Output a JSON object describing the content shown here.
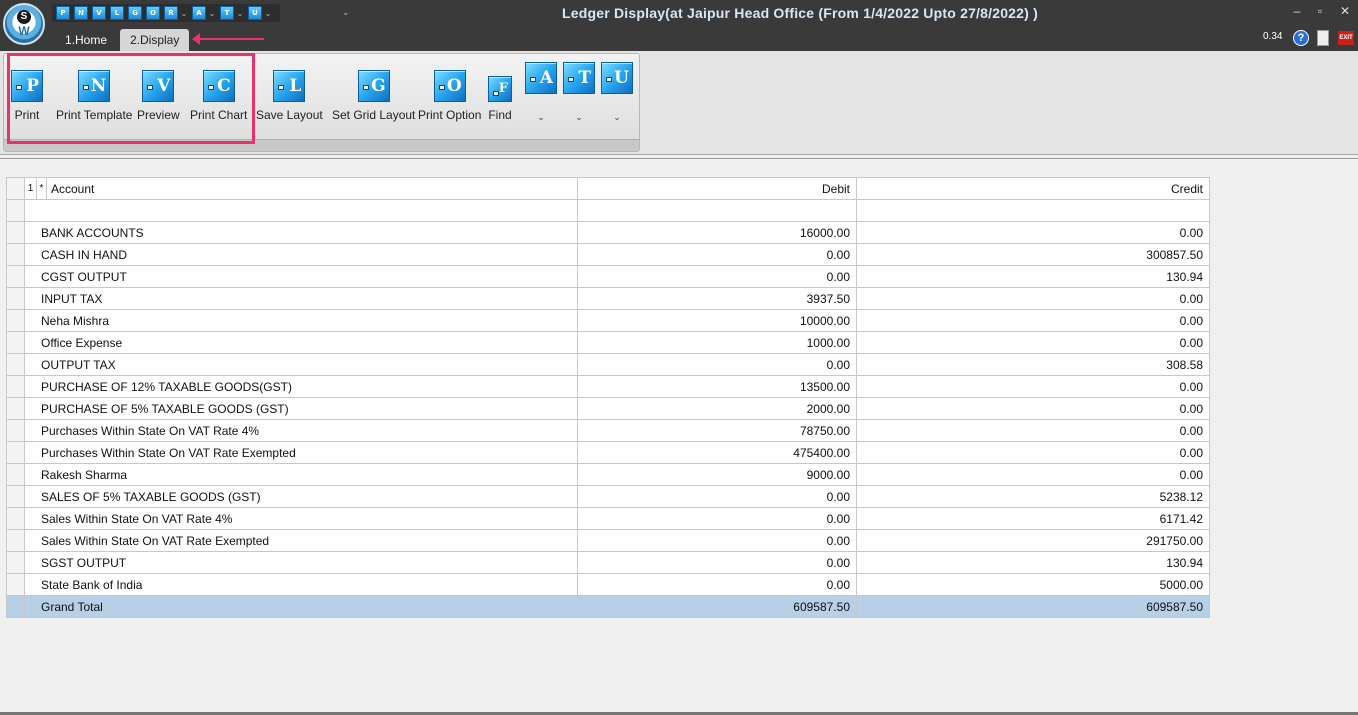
{
  "window": {
    "title": "Ledger Display(at Jaipur Head Office  (From 1/4/2022 Upto 27/8/2022) )",
    "version": "0.34"
  },
  "quick_access": [
    {
      "letter": "P",
      "icon": "print-icon"
    },
    {
      "letter": "N",
      "icon": "print-template-icon"
    },
    {
      "letter": "V",
      "icon": "preview-icon"
    },
    {
      "letter": "L",
      "icon": "save-layout-icon"
    },
    {
      "letter": "G",
      "icon": "grid-layout-icon"
    },
    {
      "letter": "O",
      "icon": "print-option-icon"
    },
    {
      "letter": "R",
      "icon": "r-icon"
    },
    {
      "letter": "A",
      "icon": "a-icon"
    },
    {
      "letter": "T",
      "icon": "t-icon"
    },
    {
      "letter": "U",
      "icon": "u-icon"
    }
  ],
  "tabs": [
    {
      "label": "1.Home"
    },
    {
      "label": "2.Display"
    }
  ],
  "ribbon": {
    "buttons": [
      {
        "letter": "P",
        "label": "Print"
      },
      {
        "letter": "N",
        "label": "Print Template"
      },
      {
        "letter": "V",
        "label": "Preview"
      },
      {
        "letter": "C",
        "label": "Print Chart"
      },
      {
        "letter": "L",
        "label": "Save Layout"
      },
      {
        "letter": "G",
        "label": "Set Grid Layout"
      },
      {
        "letter": "O",
        "label": "Print Option"
      },
      {
        "letter": "F",
        "label": "Find"
      }
    ],
    "dropdowns": [
      {
        "letter": "A"
      },
      {
        "letter": "T"
      },
      {
        "letter": "U"
      }
    ],
    "dropdown_glyph": "⌄"
  },
  "grid": {
    "header": {
      "level": "1",
      "star": "*",
      "account": "Account",
      "debit": "Debit",
      "credit": "Credit"
    },
    "rows": [
      {
        "account": "BANK ACCOUNTS",
        "debit": "16000.00",
        "credit": "0.00"
      },
      {
        "account": "CASH IN HAND",
        "debit": "0.00",
        "credit": "300857.50"
      },
      {
        "account": "CGST OUTPUT",
        "debit": "0.00",
        "credit": "130.94"
      },
      {
        "account": "INPUT TAX",
        "debit": "3937.50",
        "credit": "0.00"
      },
      {
        "account": "Neha Mishra",
        "debit": "10000.00",
        "credit": "0.00"
      },
      {
        "account": "Office Expense",
        "debit": "1000.00",
        "credit": "0.00"
      },
      {
        "account": "OUTPUT TAX",
        "debit": "0.00",
        "credit": "308.58"
      },
      {
        "account": "PURCHASE OF 12% TAXABLE GOODS(GST)",
        "debit": "13500.00",
        "credit": "0.00"
      },
      {
        "account": "PURCHASE OF 5% TAXABLE GOODS (GST)",
        "debit": "2000.00",
        "credit": "0.00"
      },
      {
        "account": "Purchases Within State On VAT Rate 4%",
        "debit": "78750.00",
        "credit": "0.00"
      },
      {
        "account": "Purchases Within State On VAT Rate Exempted",
        "debit": "475400.00",
        "credit": "0.00"
      },
      {
        "account": "Rakesh Sharma",
        "debit": "9000.00",
        "credit": "0.00"
      },
      {
        "account": "SALES OF 5% TAXABLE GOODS (GST)",
        "debit": "0.00",
        "credit": "5238.12"
      },
      {
        "account": "Sales Within State On VAT Rate 4%",
        "debit": "0.00",
        "credit": "6171.42"
      },
      {
        "account": "Sales Within State On VAT Rate Exempted",
        "debit": "0.00",
        "credit": "291750.00"
      },
      {
        "account": "SGST OUTPUT",
        "debit": "0.00",
        "credit": "130.94"
      },
      {
        "account": "State Bank of India",
        "debit": "0.00",
        "credit": "5000.00"
      }
    ],
    "total": {
      "account": "Grand Total",
      "debit": "609587.50",
      "credit": "609587.50"
    }
  },
  "colors": {
    "accent_highlight": "#e8336a",
    "total_row": "#b8cfe8",
    "titlebar": "#3a3a3a",
    "icon_blue": "#29a6f0"
  }
}
